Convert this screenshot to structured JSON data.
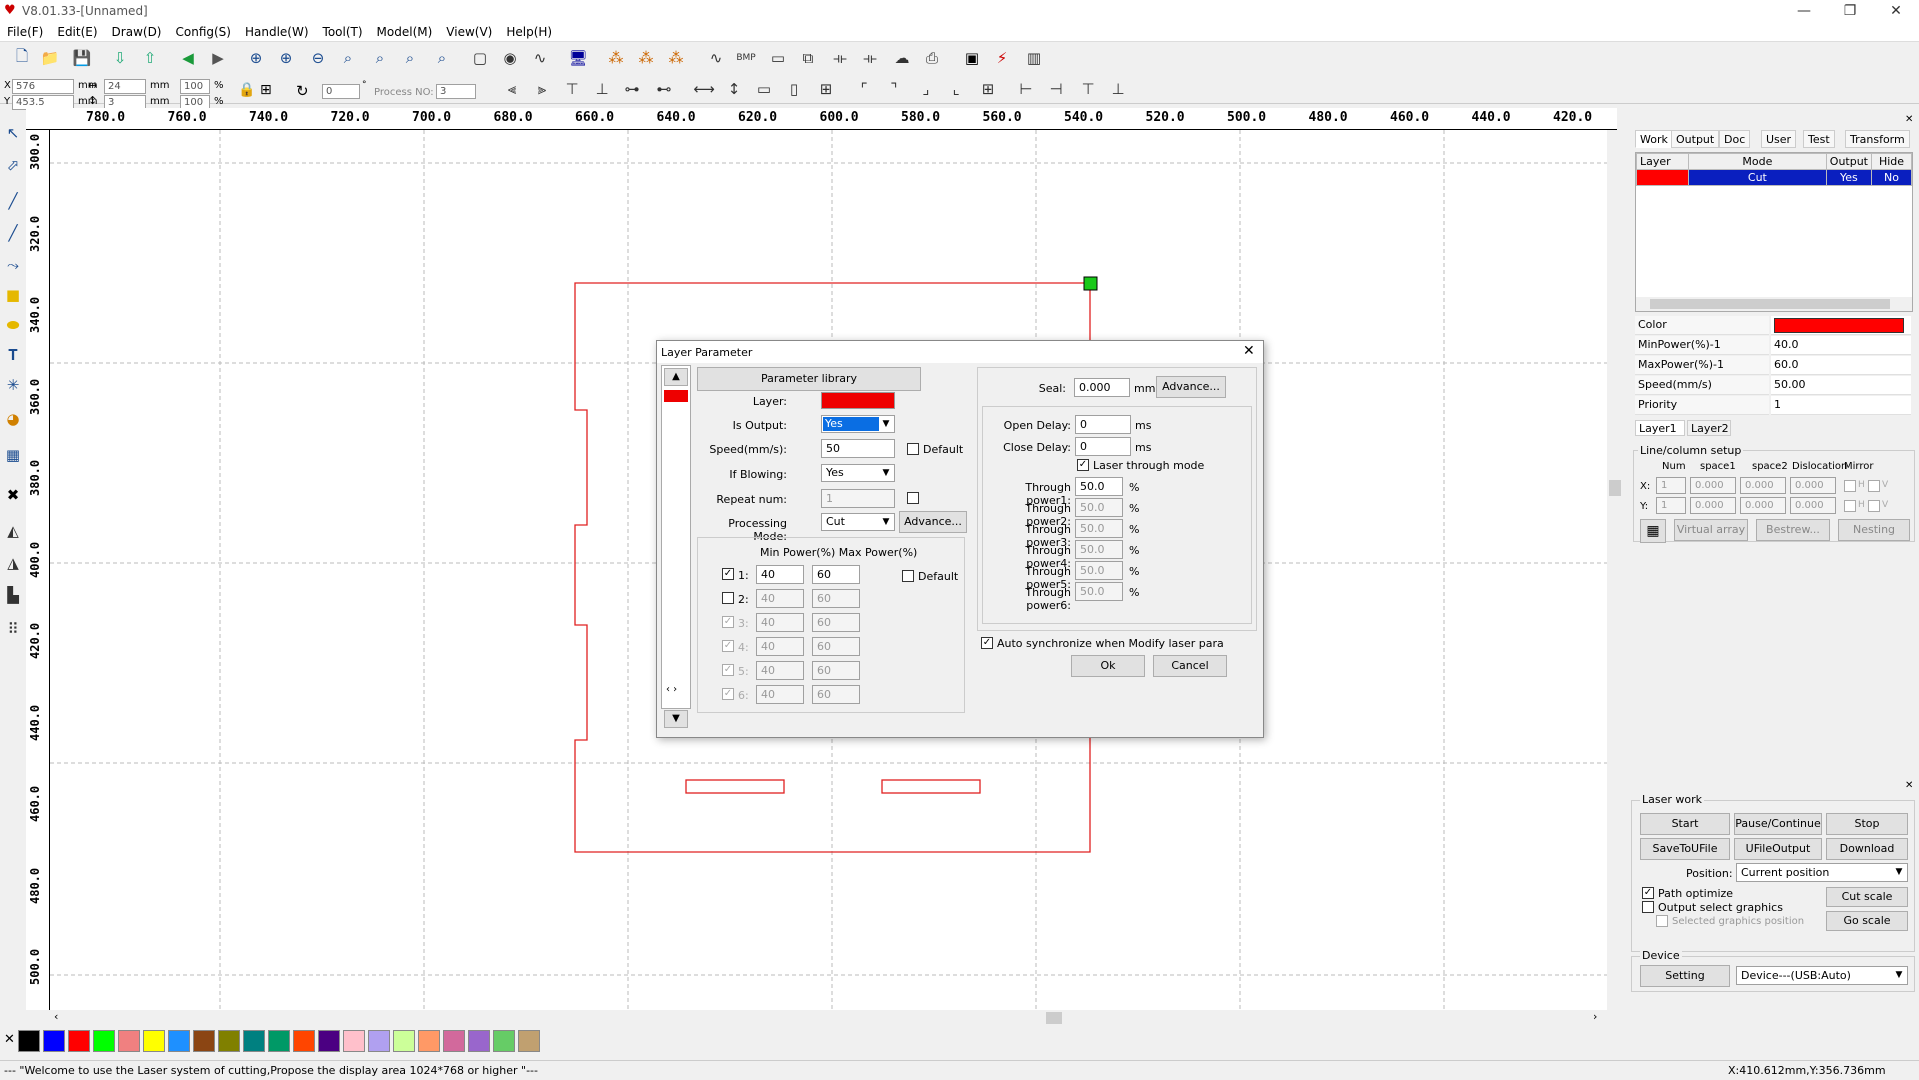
{
  "app": {
    "title": "V8.01.33-[Unnamed]"
  },
  "menu": [
    "File(F)",
    "Edit(E)",
    "Draw(D)",
    "Config(S)",
    "Handle(W)",
    "Tool(T)",
    "Model(M)",
    "View(V)",
    "Help(H)"
  ],
  "coords": {
    "x_label": "X",
    "y_label": "Y",
    "x_value": "576",
    "y_value": "453.5",
    "w_value": "24",
    "h_value": "3",
    "unit": "mm",
    "pct1": "100",
    "pct2": "100",
    "pct": "%",
    "rotate": "0",
    "process_no_label": "Process NO:",
    "process_no": "3"
  },
  "ruler": {
    "h": [
      "780.0",
      "760.0",
      "740.0",
      "720.0",
      "700.0",
      "680.0",
      "660.0",
      "640.0",
      "620.0",
      "600.0",
      "580.0",
      "560.0",
      "540.0",
      "520.0",
      "500.0",
      "480.0",
      "460.0",
      "440.0",
      "420.0"
    ],
    "v": [
      "300.0",
      "320.0",
      "340.0",
      "360.0",
      "380.0",
      "400.0",
      "420.0",
      "440.0",
      "460.0",
      "480.0",
      "500.0"
    ]
  },
  "palette": [
    "#000000",
    "#0000ff",
    "#ff0000",
    "#00ff00",
    "#f08080",
    "#ffff00",
    "#1e90ff",
    "#8b4513",
    "#808000",
    "#008080",
    "#009966",
    "#ff4500",
    "#4b0082",
    "#ffc0cb",
    "#b0a0f0",
    "#ccff99",
    "#ff9966",
    "#d2699c",
    "#9966cc",
    "#66cc66",
    "#c0a070"
  ],
  "status": {
    "message": "--- \"Welcome to use the Laser system of cutting,Propose the display area 1024*768 or higher \"---",
    "coords": "X:410.612mm,Y:356.736mm"
  },
  "right": {
    "tabs": [
      "Work",
      "Output",
      "Doc",
      "User",
      "Test",
      "Transform"
    ],
    "layer_table": {
      "headers": [
        "Layer",
        "Mode",
        "Output",
        "Hide"
      ],
      "row": {
        "color": "#ff0000",
        "mode": "Cut",
        "output": "Yes",
        "hide": "No"
      }
    },
    "props": [
      {
        "k": "Color",
        "v": ""
      },
      {
        "k": "MinPower(%)-1",
        "v": "40.0"
      },
      {
        "k": "MaxPower(%)-1",
        "v": "60.0"
      },
      {
        "k": "Speed(mm/s)",
        "v": "50.00"
      },
      {
        "k": "Priority",
        "v": "1"
      }
    ],
    "layer_tabs": [
      "Layer1",
      "Layer2"
    ],
    "array": {
      "title": "Line/column setup",
      "num": "Num",
      "space1": "space1",
      "space2": "space2",
      "dislocation": "Dislocation",
      "mirror": "Mirror",
      "x": "X:",
      "y": "Y:",
      "one": "1",
      "zero": "0.000",
      "h": "H",
      "v": "V",
      "virtual_array": "Virtual array",
      "bestrew": "Bestrew...",
      "nesting": "Nesting"
    },
    "laserwork": {
      "title": "Laser work",
      "start": "Start",
      "pause": "Pause/Continue",
      "stop": "Stop",
      "save": "SaveToUFile",
      "ufile": "UFileOutput",
      "download": "Download",
      "position_label": "Position:",
      "position": "Current position",
      "path_optimize": "Path optimize",
      "output_select": "Output select graphics",
      "selected_pos": "Selected graphics position",
      "cut_scale": "Cut scale",
      "go_scale": "Go scale"
    },
    "device": {
      "title": "Device",
      "setting": "Setting",
      "device": "Device---(USB:Auto)"
    }
  },
  "dialog": {
    "title": "Layer Parameter",
    "param_lib": "Parameter library",
    "layer_label": "Layer:",
    "is_output_label": "Is Output:",
    "is_output": "Yes",
    "speed_label": "Speed(mm/s):",
    "speed": "50",
    "default": "Default",
    "blowing_label": "If Blowing:",
    "blowing": "Yes",
    "repeat_label": "Repeat num:",
    "repeat": "1",
    "mode_label": "Processing Mode:",
    "mode": "Cut",
    "advance": "Advance...",
    "power_header": "Min Power(%) Max Power(%)",
    "powers": [
      {
        "n": "1:",
        "min": "40",
        "max": "60"
      },
      {
        "n": "2:",
        "min": "40",
        "max": "60"
      },
      {
        "n": "3:",
        "min": "40",
        "max": "60"
      },
      {
        "n": "4:",
        "min": "40",
        "max": "60"
      },
      {
        "n": "5:",
        "min": "40",
        "max": "60"
      },
      {
        "n": "6:",
        "min": "40",
        "max": "60"
      }
    ],
    "seal_label": "Seal:",
    "seal": "0.000",
    "mm": "mm",
    "open_delay_label": "Open Delay:",
    "open_delay": "0",
    "close_delay_label": "Close Delay:",
    "close_delay": "0",
    "ms": "ms",
    "through_mode": "Laser through mode",
    "through": [
      {
        "l": "Through power1:",
        "v": "50.0"
      },
      {
        "l": "Through power2:",
        "v": "50.0"
      },
      {
        "l": "Through power3:",
        "v": "50.0"
      },
      {
        "l": "Through power4:",
        "v": "50.0"
      },
      {
        "l": "Through power5:",
        "v": "50.0"
      },
      {
        "l": "Through power6:",
        "v": "50.0"
      }
    ],
    "auto_sync": "Auto synchronize when Modify laser para",
    "ok": "Ok",
    "cancel": "Cancel"
  }
}
